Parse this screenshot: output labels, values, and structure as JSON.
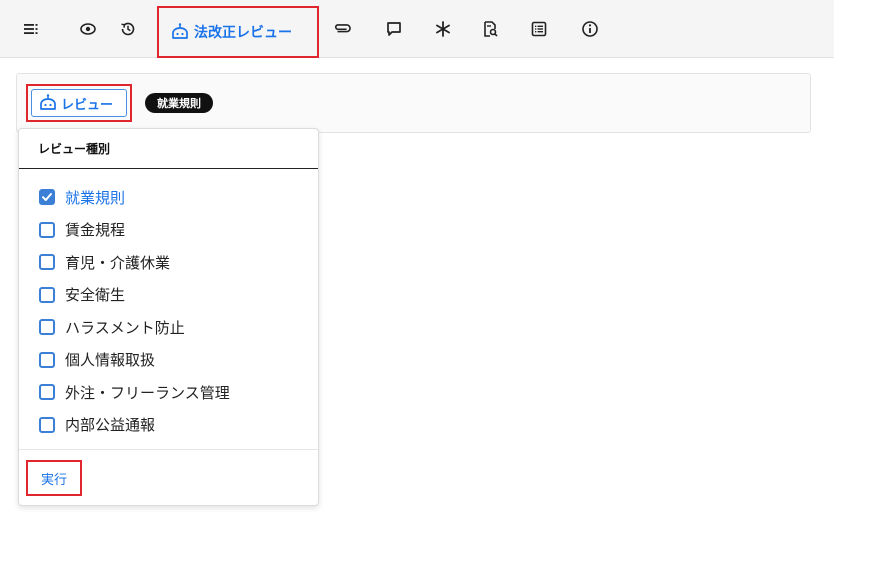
{
  "toolbar": {
    "icons": [
      "menu-icon",
      "eye-icon",
      "history-icon",
      "paperclip-icon",
      "comment-icon",
      "asterisk-icon",
      "document-search-icon",
      "list-icon",
      "info-icon"
    ],
    "active_tab_label": "法改正レビュー",
    "active_tab_icon": "robot-icon"
  },
  "review_bar": {
    "review_button_label": "レビュー",
    "review_button_icon": "robot-icon",
    "selected_chip": "就業規則"
  },
  "dropdown": {
    "header": "レビュー種別",
    "options": [
      {
        "label": "就業規則",
        "checked": true
      },
      {
        "label": "賃金規程",
        "checked": false
      },
      {
        "label": "育児・介護休業",
        "checked": false
      },
      {
        "label": "安全衛生",
        "checked": false
      },
      {
        "label": "ハラスメント防止",
        "checked": false
      },
      {
        "label": "個人情報取扱",
        "checked": false
      },
      {
        "label": "外注・フリーランス管理",
        "checked": false
      },
      {
        "label": "内部公益通報",
        "checked": false
      }
    ],
    "run_label": "実行"
  },
  "colors": {
    "accent": "#1a73e8",
    "highlight": "#e0262d",
    "checkbox": "#3b7fd6"
  }
}
